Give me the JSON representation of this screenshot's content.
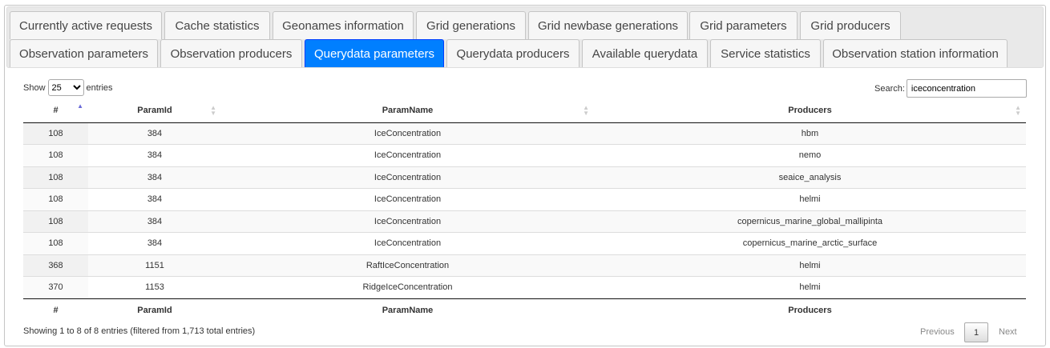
{
  "tabs_row1": [
    "Currently active requests",
    "Cache statistics",
    "Geonames information",
    "Grid generations",
    "Grid newbase generations",
    "Grid parameters",
    "Grid producers"
  ],
  "tabs_row2": [
    "Observation parameters",
    "Observation producers",
    "Querydata parameters",
    "Querydata producers",
    "Available querydata",
    "Service statistics",
    "Observation station information"
  ],
  "active_tab": "Querydata parameters",
  "accent_color": "#007fff",
  "length": {
    "show": "Show",
    "value": "25",
    "entries": "entries"
  },
  "search": {
    "label": "Search:",
    "value": "iceconcentration"
  },
  "columns": [
    "#",
    "ParamId",
    "ParamName",
    "Producers"
  ],
  "sort": {
    "column": "#",
    "direction": "asc"
  },
  "rows": [
    [
      "108",
      "384",
      "IceConcentration",
      "hbm"
    ],
    [
      "108",
      "384",
      "IceConcentration",
      "nemo"
    ],
    [
      "108",
      "384",
      "IceConcentration",
      "seaice_analysis"
    ],
    [
      "108",
      "384",
      "IceConcentration",
      "helmi"
    ],
    [
      "108",
      "384",
      "IceConcentration",
      "copernicus_marine_global_mallipinta"
    ],
    [
      "108",
      "384",
      "IceConcentration",
      "copernicus_marine_arctic_surface"
    ],
    [
      "368",
      "1151",
      "RaftIceConcentration",
      "helmi"
    ],
    [
      "370",
      "1153",
      "RidgeIceConcentration",
      "helmi"
    ]
  ],
  "info": "Showing 1 to 8 of 8 entries (filtered from 1,713 total entries)",
  "pagination": {
    "previous": "Previous",
    "page": "1",
    "next": "Next"
  }
}
